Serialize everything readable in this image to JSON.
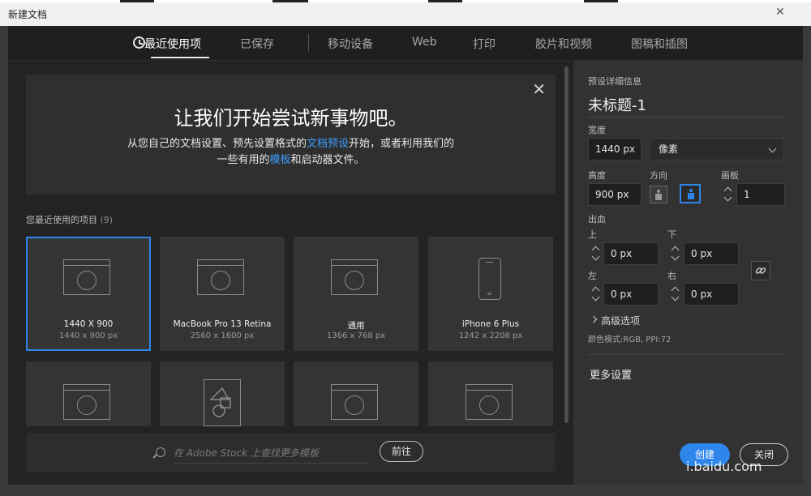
{
  "window": {
    "title": "新建文档",
    "close_glyph": "✕"
  },
  "nav": {
    "tabs": [
      {
        "label": "最近使用项",
        "active": true
      },
      {
        "label": "已保存"
      },
      {
        "label": "移动设备"
      },
      {
        "label": "Web"
      },
      {
        "label": "打印"
      },
      {
        "label": "胶片和视频"
      },
      {
        "label": "图稿和插图"
      }
    ]
  },
  "hero": {
    "title": "让我们开始尝试新事物吧。",
    "line1_a": "从您自己的文档设置、预先设置格式的",
    "line1_link": "文档预设",
    "line1_b": "开始，或者利用我们的",
    "line2_a": "一些有用的",
    "line2_link": "模板",
    "line2_b": "和启动器文件。",
    "close_glyph": "✕"
  },
  "recent": {
    "label": "您最近使用的项目",
    "count": "(9)",
    "items": [
      {
        "name": "1440 X 900",
        "size": "1440 x 900 px",
        "icon": "browser-icon",
        "selected": true
      },
      {
        "name": "MacBook Pro 13 Retina",
        "size": "2560 x 1600 px",
        "icon": "browser-icon"
      },
      {
        "name": "通用",
        "size": "1366 x 768 px",
        "icon": "browser-icon"
      },
      {
        "name": "iPhone 6 Plus",
        "size": "1242 x 2208 px",
        "icon": "phone-icon"
      }
    ],
    "second_row_icons": [
      "browser-icon",
      "shapes-document-icon",
      "browser-icon",
      "browser-icon"
    ]
  },
  "stock": {
    "placeholder": "在 Adobe Stock 上查找更多模板",
    "go_label": "前往"
  },
  "details": {
    "section_label": "预设详细信息",
    "doc_name": "未标题-1",
    "width_label": "宽度",
    "width_value": "1440 px",
    "unit": "像素",
    "height_label": "高度",
    "height_value": "900 px",
    "orientation_label": "方向",
    "artboard_label": "画板",
    "artboard_value": "1",
    "bleed_label": "出血",
    "bleed_top_label": "上",
    "bleed_top": "0 px",
    "bleed_bottom_label": "下",
    "bleed_bottom": "0 px",
    "bleed_left_label": "左",
    "bleed_left": "0 px",
    "bleed_right_label": "右",
    "bleed_right": "0 px",
    "advanced_label": "高级选项",
    "color_mode": "颜色模式:RGB, PPI:72",
    "more_settings": "更多设置"
  },
  "actions": {
    "create": "创建",
    "close": "关闭"
  },
  "watermark": "i.baidu.com",
  "colors": {
    "accent": "#2f86ea",
    "link": "#3b9dff"
  }
}
